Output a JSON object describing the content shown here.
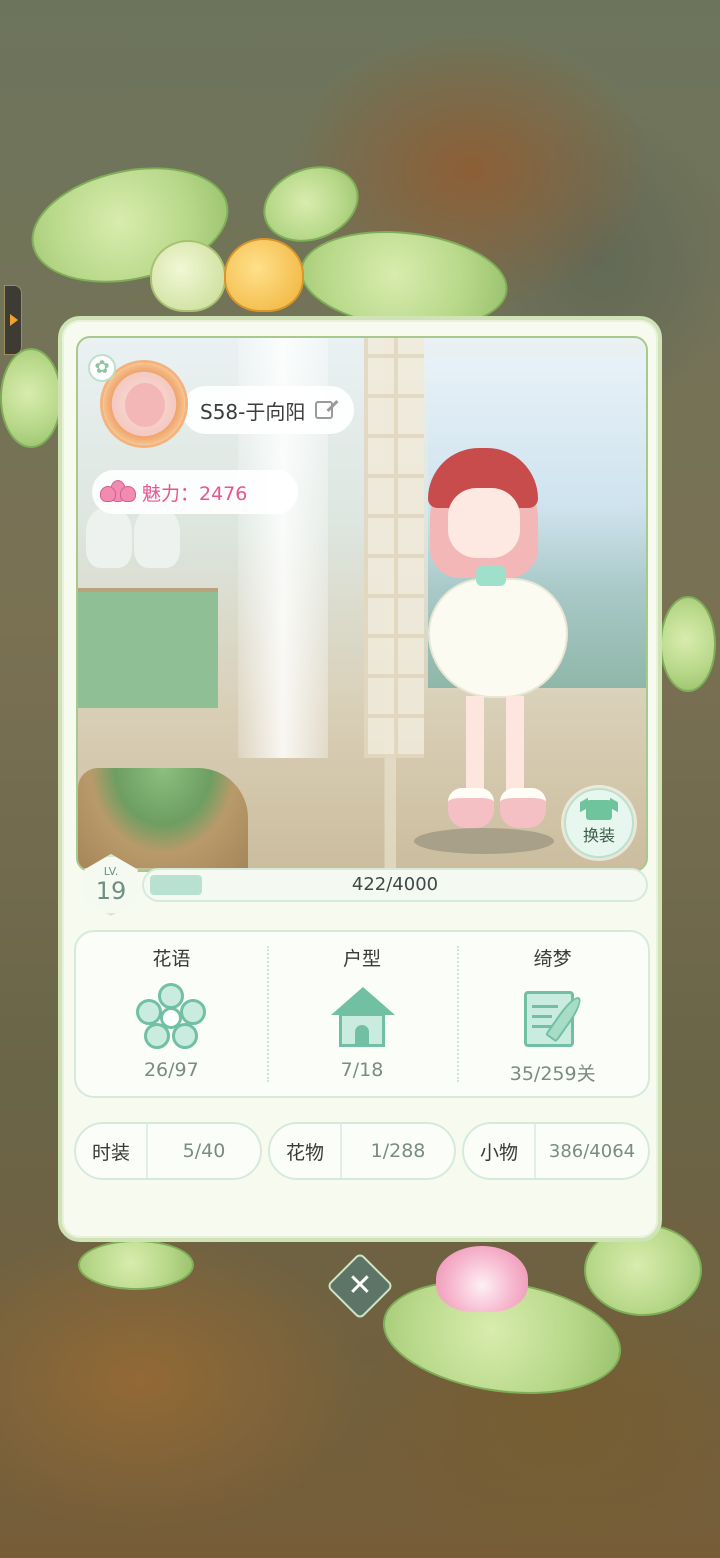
{
  "profile": {
    "name": "S58-于向阳",
    "charm_label": "魅力：2476"
  },
  "level": {
    "label": "LV.",
    "value": "19",
    "exp_text": "422/4000",
    "exp_fraction": 0.1055
  },
  "actions": {
    "change_outfit_label": "换装"
  },
  "stats": [
    {
      "title": "花语",
      "value": "26/97",
      "icon": "flower-icon"
    },
    {
      "title": "户型",
      "value": "7/18",
      "icon": "house-icon"
    },
    {
      "title": "绮梦",
      "value": "35/259关",
      "icon": "book-quill-icon"
    }
  ],
  "collections": [
    {
      "label": "时装",
      "value": "5/40"
    },
    {
      "label": "花物",
      "value": "1/288"
    },
    {
      "label": "小物",
      "value": "386/4064"
    }
  ],
  "close": {
    "glyph": "✕"
  },
  "colors": {
    "accent_green": "#72c0a4",
    "charm_pink": "#e4578e",
    "card_bg": "#f7fbef"
  }
}
